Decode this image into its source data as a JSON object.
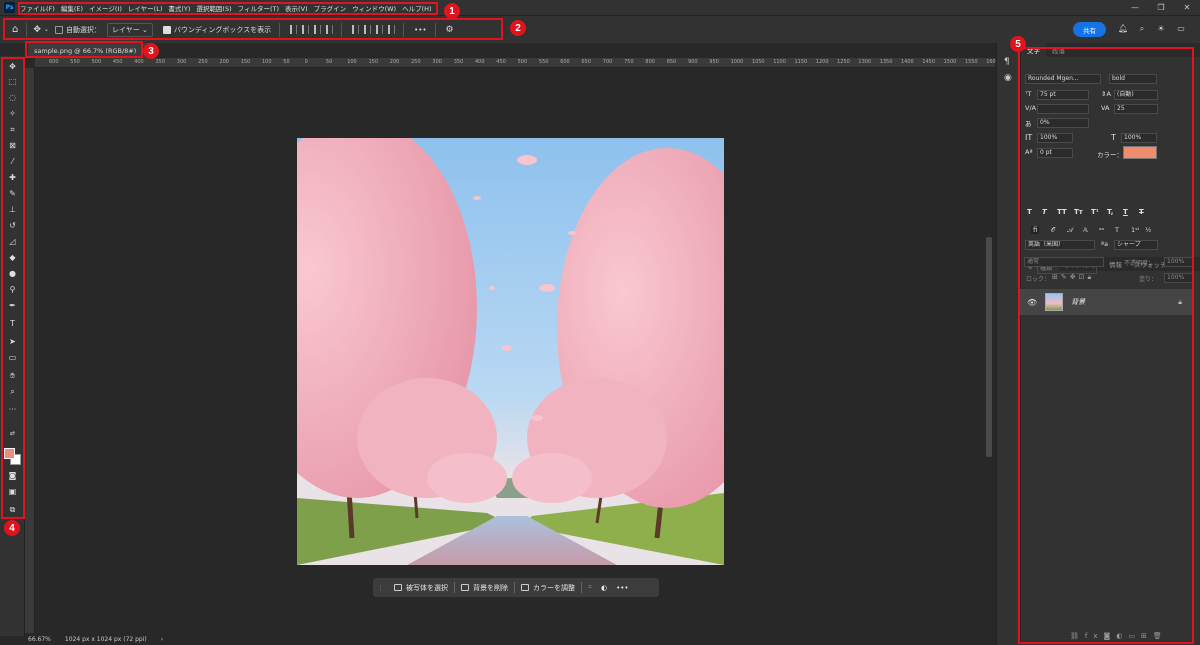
{
  "menu": {
    "logo": "Ps",
    "items": [
      "ファイル(F)",
      "編集(E)",
      "イメージ(I)",
      "レイヤー(L)",
      "書式(Y)",
      "選択範囲(S)",
      "フィルター(T)",
      "表示(V)",
      "プラグイン",
      "ウィンドウ(W)",
      "ヘルプ(H)"
    ]
  },
  "options": {
    "auto_select_label": "自動選択：",
    "auto_select_target": "レイヤー",
    "bounding_box_label": "バウンディングボックスを表示",
    "more": "•••",
    "share": "共有"
  },
  "document": {
    "tab_title": "sample.png @ 66.7% (RGB/8#)",
    "close": "×"
  },
  "ruler": {
    "ticks": [
      "600",
      "550",
      "500",
      "450",
      "400",
      "350",
      "300",
      "250",
      "200",
      "150",
      "100",
      "50",
      "0",
      "50",
      "100",
      "150",
      "200",
      "250",
      "300",
      "350",
      "400",
      "450",
      "500",
      "550",
      "600",
      "650",
      "700",
      "750",
      "800",
      "850",
      "900",
      "950",
      "1000",
      "1050",
      "1100",
      "1150",
      "1200",
      "1250",
      "1300",
      "1350",
      "1400",
      "1450",
      "1500",
      "1550",
      "1600"
    ]
  },
  "status": {
    "zoom": "66.67%",
    "doc_info": "1024 px x 1024 px (72 ppi)",
    "arrow": "›"
  },
  "contextual": {
    "select_subject": "被写体を選択",
    "remove_bg": "背景を削除",
    "adjust_color": "カラーを調整",
    "more": "•••"
  },
  "character_panel": {
    "tabs": [
      "文字",
      "段落"
    ],
    "font_family": "Rounded Mgen...",
    "font_style": "bold",
    "font_size": "75 pt",
    "leading": "(自動)",
    "kerning": "",
    "tracking": "25",
    "tsume": "0%",
    "vscale": "100%",
    "hscale": "100%",
    "baseline": "0 pt",
    "color_label": "カラー：",
    "color": "#f08b6e",
    "type_buttons": [
      "T",
      "T",
      "TT",
      "Tт",
      "T¹",
      "T,",
      "T",
      "T"
    ],
    "language": "英語（米国）",
    "aa_label": "ªa",
    "antialias": "シャープ"
  },
  "layers_panel": {
    "tabs": [
      "レイヤー",
      "プロパティ",
      "情報",
      "スウォッチ"
    ],
    "search": "種類",
    "blend_mode": "通常",
    "opacity_label": "不透明度：",
    "opacity": "100%",
    "lock_label": "ロック：",
    "fill_label": "塗り：",
    "fill": "100%",
    "layer_name": "背景"
  },
  "annotations": [
    "1",
    "2",
    "3",
    "4",
    "5"
  ],
  "colors": {
    "foreground": "#f08b7a",
    "background": "#ffffff",
    "highlight": "#e0141c",
    "accent": "#1473e6"
  }
}
